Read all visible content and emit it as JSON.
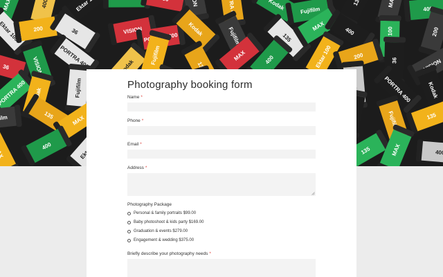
{
  "form": {
    "title": "Photography booking form",
    "required_mark": "*",
    "fields": {
      "name": {
        "label": "Name",
        "value": ""
      },
      "phone": {
        "label": "Phone",
        "value": ""
      },
      "email": {
        "label": "Email",
        "value": ""
      },
      "address": {
        "label": "Address",
        "value": ""
      },
      "needs": {
        "label": "Briefly describe your photography needs",
        "value": ""
      }
    },
    "package": {
      "label": "Photography Package",
      "options": [
        {
          "label": "Personal & family portraits $99.00",
          "selected": false
        },
        {
          "label": "Baby photoshoot & kids party $169.00",
          "selected": false
        },
        {
          "label": "Graduation & events $279.00",
          "selected": false
        },
        {
          "label": "Engagement & wedding $375.00",
          "selected": false
        }
      ]
    }
  },
  "hero": {
    "canister_labels": [
      "MAX",
      "400",
      "Ektar 100",
      "200",
      "36",
      "VISION",
      "PORTRA 400",
      "Kodak",
      "Fujifilm",
      "135"
    ]
  },
  "colors": {
    "required": "#e0443e",
    "input_bg": "#f3f3f3",
    "page_bg": "#ececec"
  }
}
